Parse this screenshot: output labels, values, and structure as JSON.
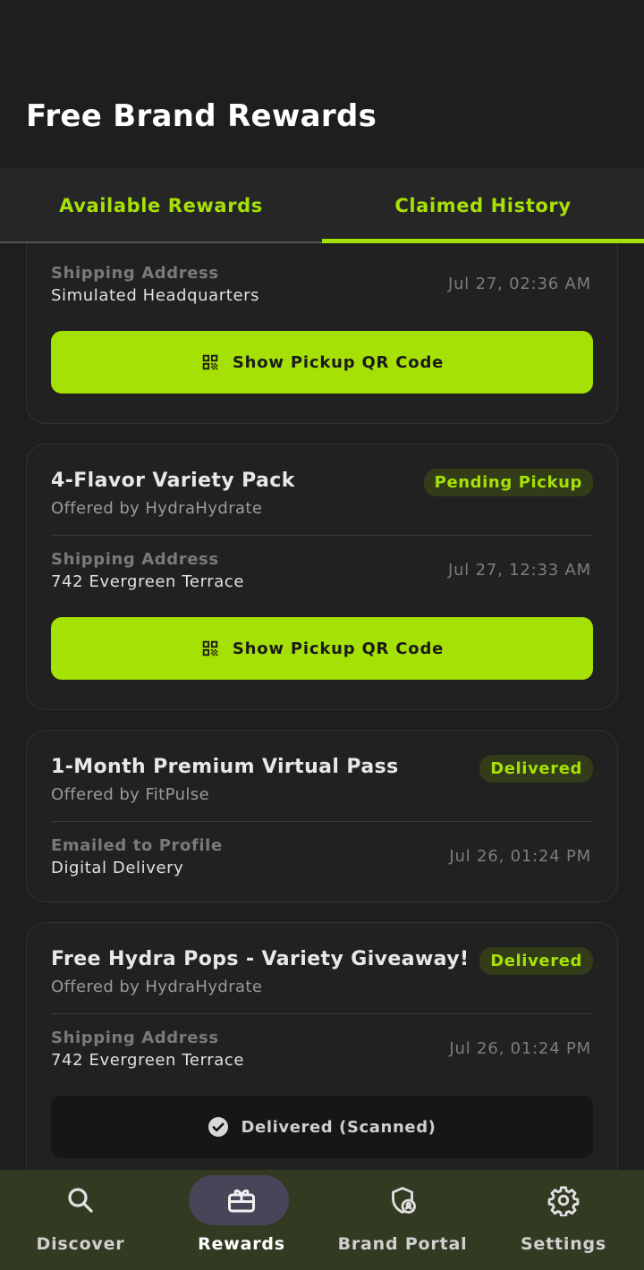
{
  "header": {
    "title": "Free Brand Rewards"
  },
  "tabs": [
    {
      "label": "Available Rewards",
      "active": false
    },
    {
      "label": "Claimed History",
      "active": true
    }
  ],
  "cards": [
    {
      "title": "",
      "offered_by": "",
      "status": "",
      "address_label": "Shipping Address",
      "address_value": "Simulated Headquarters",
      "date": "Jul 27, 02:36 AM",
      "action": "Show Pickup QR Code"
    },
    {
      "title": "4-Flavor Variety Pack",
      "offered_by": "Offered by HydraHydrate",
      "status": "Pending Pickup",
      "address_label": "Shipping Address",
      "address_value": "742 Evergreen Terrace",
      "date": "Jul 27, 12:33 AM",
      "action": "Show Pickup QR Code"
    },
    {
      "title": "1-Month Premium Virtual Pass",
      "offered_by": "Offered by FitPulse",
      "status": "Delivered",
      "address_label": "Emailed to Profile",
      "address_value": "Digital Delivery",
      "date": "Jul 26, 01:24 PM",
      "action": ""
    },
    {
      "title": "Free Hydra Pops - Variety Giveaway!",
      "offered_by": "Offered by HydraHydrate",
      "status": "Delivered",
      "address_label": "Shipping Address",
      "address_value": "742 Evergreen Terrace",
      "date": "Jul 26, 01:24 PM",
      "action": "Delivered (Scanned)"
    }
  ],
  "nav": [
    {
      "label": "Discover",
      "icon": "search-icon",
      "active": false
    },
    {
      "label": "Rewards",
      "icon": "gift-icon",
      "active": true
    },
    {
      "label": "Brand Portal",
      "icon": "shield-user-icon",
      "active": false
    },
    {
      "label": "Settings",
      "icon": "gear-icon",
      "active": false
    }
  ],
  "colors": {
    "accent": "#a6e106",
    "background": "#1e1e1e",
    "nav_background": "#323a22",
    "nav_active_pill": "#4a4458"
  }
}
